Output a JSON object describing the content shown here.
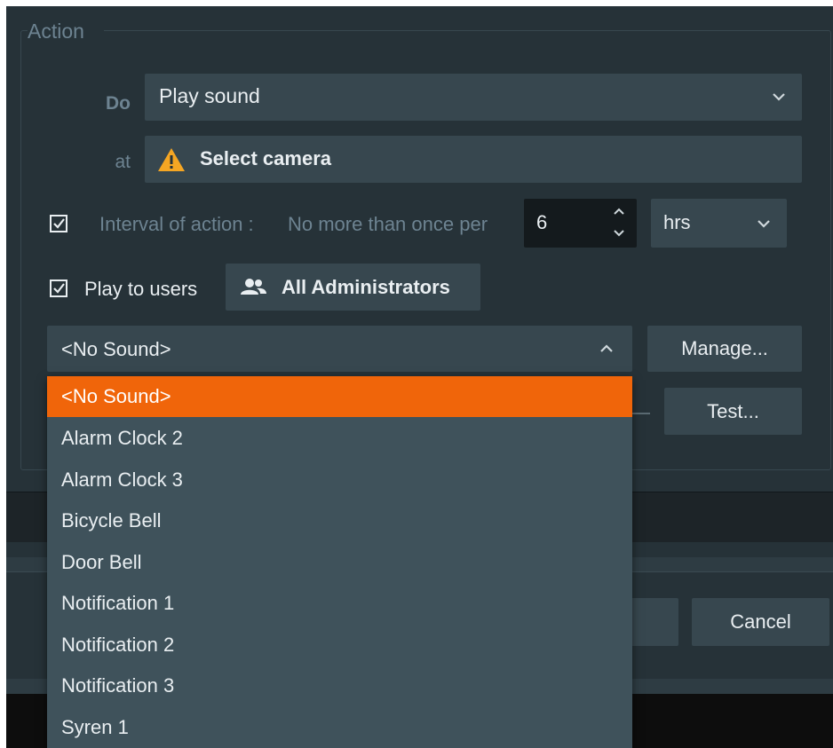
{
  "action_group": {
    "title": "Action",
    "do_label": "Do",
    "do_value": "Play sound",
    "at_label": "at",
    "at_value": "Select camera",
    "interval": {
      "label": "Interval of action :",
      "sublabel": "No more than once per",
      "value": "6",
      "unit": "hrs",
      "checked": true
    },
    "play_to_users": {
      "label": "Play to users",
      "checked": true,
      "users_button": "All Administrators"
    },
    "sound": {
      "value": "<No Sound>",
      "manage_button": "Manage...",
      "test_button": "Test..."
    }
  },
  "dropdown": {
    "items": [
      "<No Sound>",
      "Alarm Clock 2",
      "Alarm Clock 3",
      "Bicycle Bell",
      "Door Bell",
      "Notification 1",
      "Notification 2",
      "Notification 3",
      "Syren 1"
    ],
    "selected_index": 0
  },
  "footer": {
    "cancel_button": "Cancel"
  },
  "colors": {
    "background": "#263238",
    "field": "#37474f",
    "accent": "#f0650a",
    "warning": "#f5a623"
  },
  "icons": {
    "warning": "warning-icon",
    "users": "users-icon",
    "checkbox": "checkbox-checked-icon",
    "chevron": "chevron-down-icon"
  }
}
